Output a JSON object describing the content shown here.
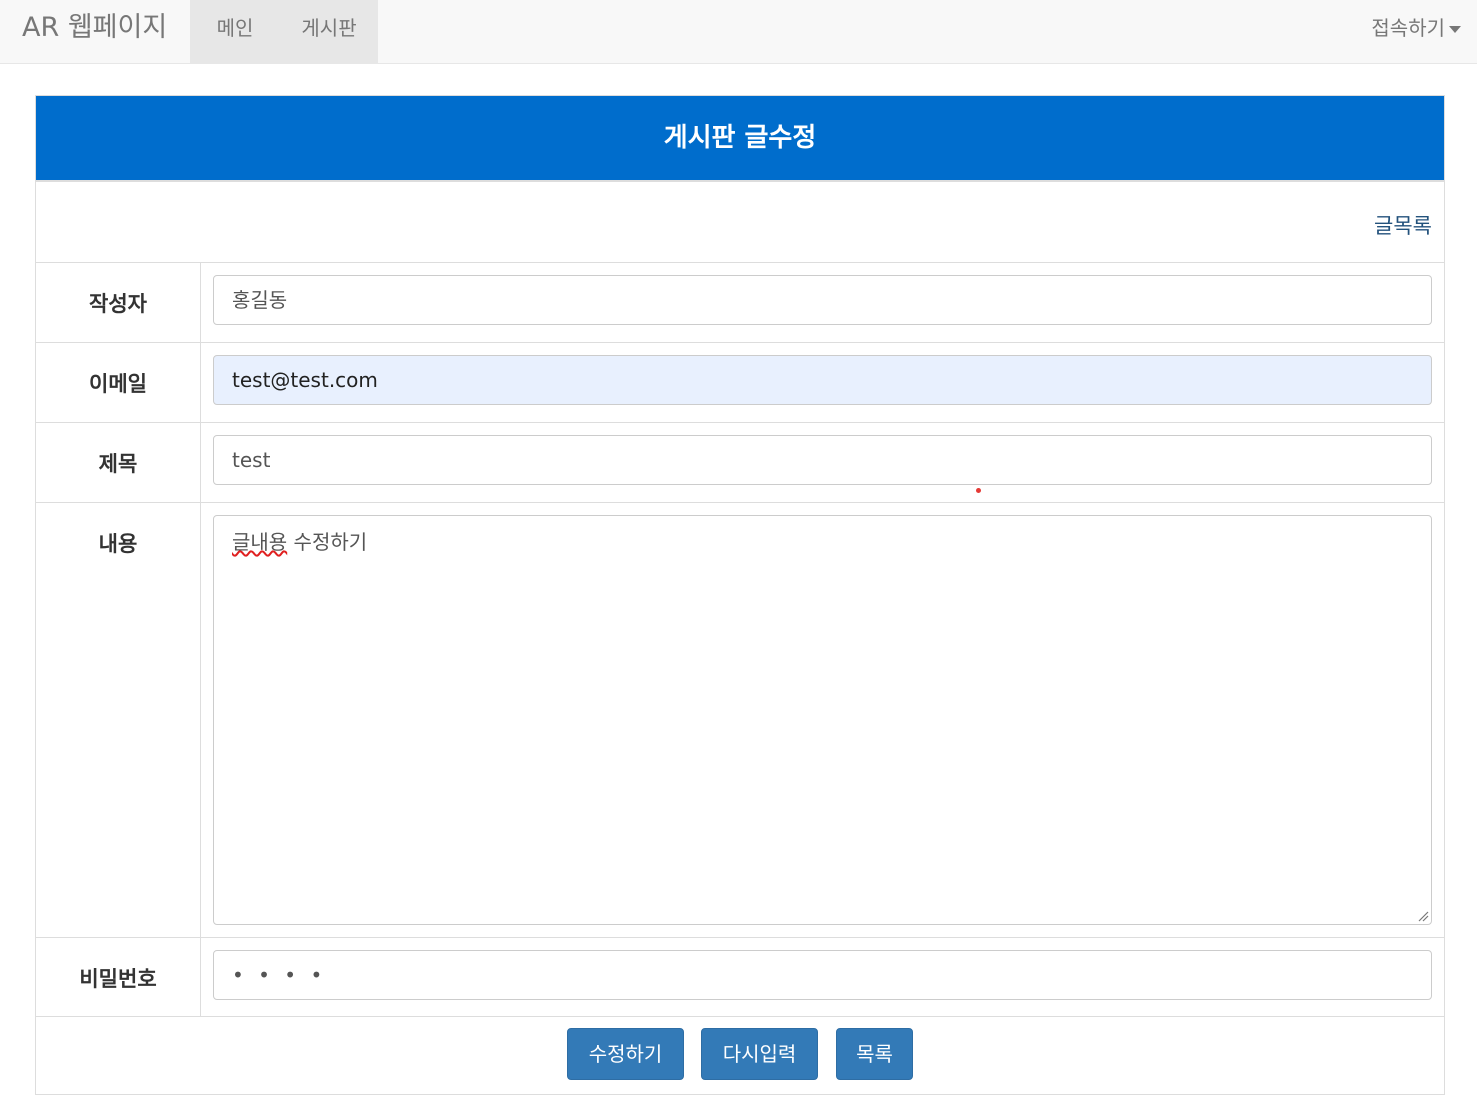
{
  "navbar": {
    "brand": "AR 웹페이지",
    "items": [
      {
        "label": "메인"
      },
      {
        "label": "게시판"
      }
    ],
    "connect_label": "접속하기"
  },
  "panel": {
    "title": "게시판 글수정",
    "list_link": "글목록"
  },
  "form": {
    "author_label": "작성자",
    "author_value": "홍길동",
    "email_label": "이메일",
    "email_value": "test@test.com",
    "subject_label": "제목",
    "subject_value": "test",
    "content_label": "내용",
    "content_value_word1": "글내용",
    "content_value_rest": " 수정하기",
    "password_label": "비밀번호",
    "password_mask": "• • • •"
  },
  "buttons": {
    "submit": "수정하기",
    "reset": "다시입력",
    "list": "목록"
  }
}
